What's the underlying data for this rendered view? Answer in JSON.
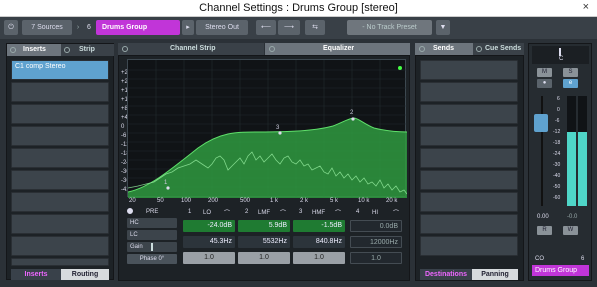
{
  "window": {
    "title": "Channel Settings : Drums Group [stereo]",
    "close": "×"
  },
  "toolbar": {
    "sources_label": "7 Sources",
    "sources_arrow": "›",
    "track_number": "6",
    "track_name": "Drums Group",
    "output_label": "Stereo Out",
    "prev": "⟵",
    "next": "⟶",
    "link": "⇆",
    "preset_label": "- No Track Preset",
    "menu": "▼"
  },
  "left": {
    "tabs": [
      "Inserts",
      "Strip"
    ],
    "insert_slots": [
      "C1 comp Stereo",
      "",
      "",
      "",
      "",
      "",
      "",
      "",
      "",
      ""
    ],
    "bottom_tabs": [
      "Inserts",
      "Routing"
    ]
  },
  "center": {
    "tabs": [
      "Channel Strip",
      "Equalizer"
    ],
    "y_ticks": [
      "+24",
      "+20",
      "+16",
      "+12",
      "+8",
      "+4",
      "0",
      "-6",
      "-12",
      "-18",
      "-24",
      "-30",
      "-36",
      "-42",
      "-48"
    ],
    "x_ticks": [
      "20",
      "50",
      "100",
      "200",
      "500",
      "1 k",
      "2 k",
      "5 k",
      "10 k",
      "20 k"
    ],
    "markers": {
      "m1": "1",
      "m2": "2",
      "m3": "3"
    },
    "controls": {
      "pre": "PRE",
      "hc": "HC",
      "lc": "LC",
      "gain": "Gain",
      "phase": "Phase 0°",
      "bands": [
        {
          "num": "1",
          "name": "LO",
          "gain": "-24.0dB",
          "freq": "45.3Hz",
          "q": "1.0"
        },
        {
          "num": "2",
          "name": "LMF",
          "gain": "5.9dB",
          "freq": "5532Hz",
          "q": "1.0"
        },
        {
          "num": "3",
          "name": "HMF",
          "gain": "-1.5dB",
          "freq": "840.8Hz",
          "q": "1.0"
        },
        {
          "num": "4",
          "name": "HI",
          "gain": "0.0dB",
          "freq": "12000Hz",
          "q": "1.0"
        }
      ]
    }
  },
  "right": {
    "tabs": [
      "Sends",
      "Cue Sends"
    ],
    "bottom_tabs": [
      "Destinations",
      "Panning"
    ]
  },
  "strip": {
    "pan_value": "C",
    "m_label": "M",
    "s_label": "S",
    "o_label": "●",
    "e_label": "e",
    "scale": [
      "6",
      "0",
      "-6",
      "-12",
      "-18",
      "-24",
      "-30",
      "-40",
      "-50",
      "-60"
    ],
    "readout_left": "0.00",
    "readout_right": "-0.0",
    "r_label": "R",
    "w_label": "W",
    "link_icon": "CO",
    "channel_number": "6",
    "channel_name": "Drums Group"
  },
  "colors": {
    "accent": "#c135d8",
    "eq_green": "#3fc24d",
    "selected_insert": "#5fa2cf"
  }
}
